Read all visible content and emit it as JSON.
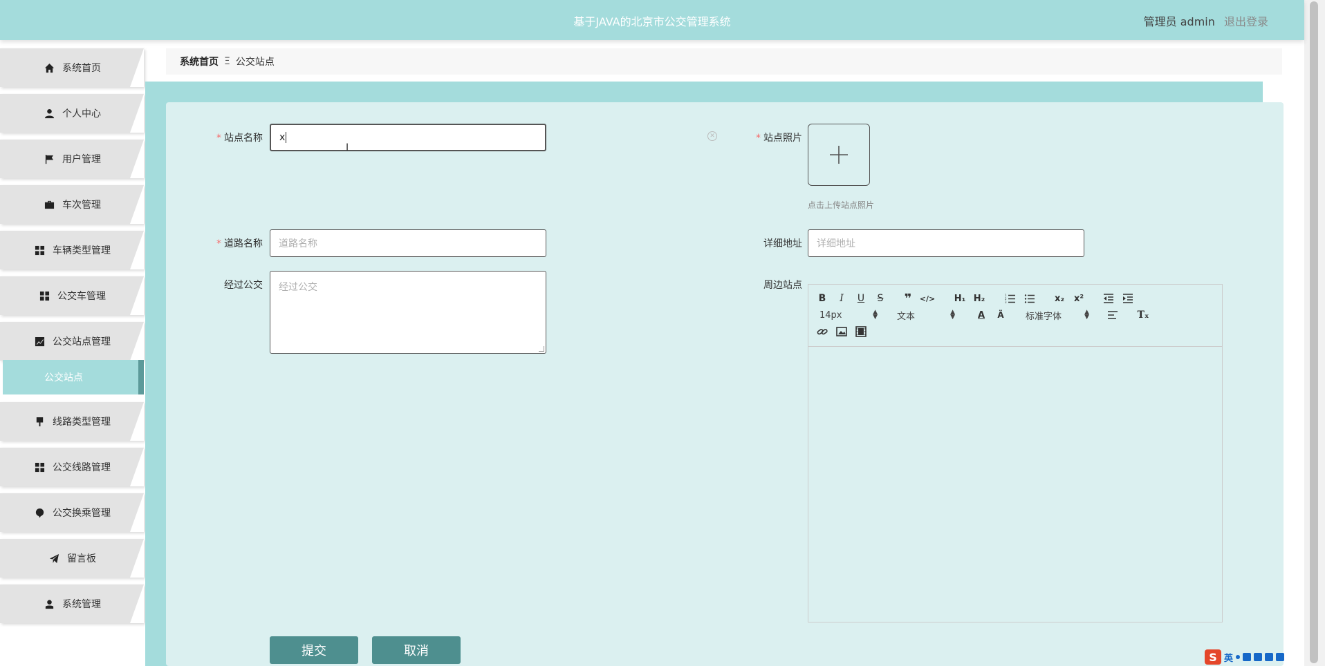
{
  "header": {
    "title": "基于JAVA的北京市公交管理系统",
    "user": "管理员 admin",
    "logout": "退出登录"
  },
  "sidebar": {
    "items": [
      {
        "label": "系统首页",
        "icon": "home-icon"
      },
      {
        "label": "个人中心",
        "icon": "user-icon"
      },
      {
        "label": "用户管理",
        "icon": "flag-icon"
      },
      {
        "label": "车次管理",
        "icon": "briefcase-icon"
      },
      {
        "label": "车辆类型管理",
        "icon": "grid-icon"
      },
      {
        "label": "公交车管理",
        "icon": "grid-icon"
      },
      {
        "label": "公交站点管理",
        "icon": "chart-icon"
      },
      {
        "label": "线路类型管理",
        "icon": "brush-icon"
      },
      {
        "label": "公交线路管理",
        "icon": "grid-icon"
      },
      {
        "label": "公交换乘管理",
        "icon": "pin-icon"
      },
      {
        "label": "留言板",
        "icon": "send-icon"
      },
      {
        "label": "系统管理",
        "icon": "admin-icon"
      }
    ],
    "active_sub": "公交站点"
  },
  "breadcrumb": {
    "home": "系统首页",
    "separator": "Ξ",
    "current": "公交站点"
  },
  "form": {
    "station_name": {
      "label": "站点名称",
      "value": "x"
    },
    "station_photo": {
      "label": "站点照片",
      "hint": "点击上传站点照片"
    },
    "road_name": {
      "label": "道路名称",
      "placeholder": "道路名称"
    },
    "address": {
      "label": "详细地址",
      "placeholder": "详细地址"
    },
    "passing_buses": {
      "label": "经过公交",
      "placeholder": "经过公交"
    },
    "nearby_stations": {
      "label": "周边站点"
    },
    "submit": "提交",
    "cancel": "取消"
  },
  "editor": {
    "font_size": "14px",
    "paragraph": "文本",
    "font_family": "标准字体",
    "buttons": [
      "bold-icon",
      "italic-icon",
      "underline-icon",
      "strike-icon",
      "quote-icon",
      "code-icon",
      "h1-icon",
      "h2-icon",
      "ordered-list-icon",
      "bullet-list-icon",
      "subscript-icon",
      "superscript-icon",
      "outdent-icon",
      "indent-icon",
      "font-color-icon",
      "background-color-icon",
      "align-icon",
      "clear-format-icon",
      "link-icon",
      "image-icon",
      "video-icon"
    ]
  },
  "ime": {
    "lang": "英"
  }
}
